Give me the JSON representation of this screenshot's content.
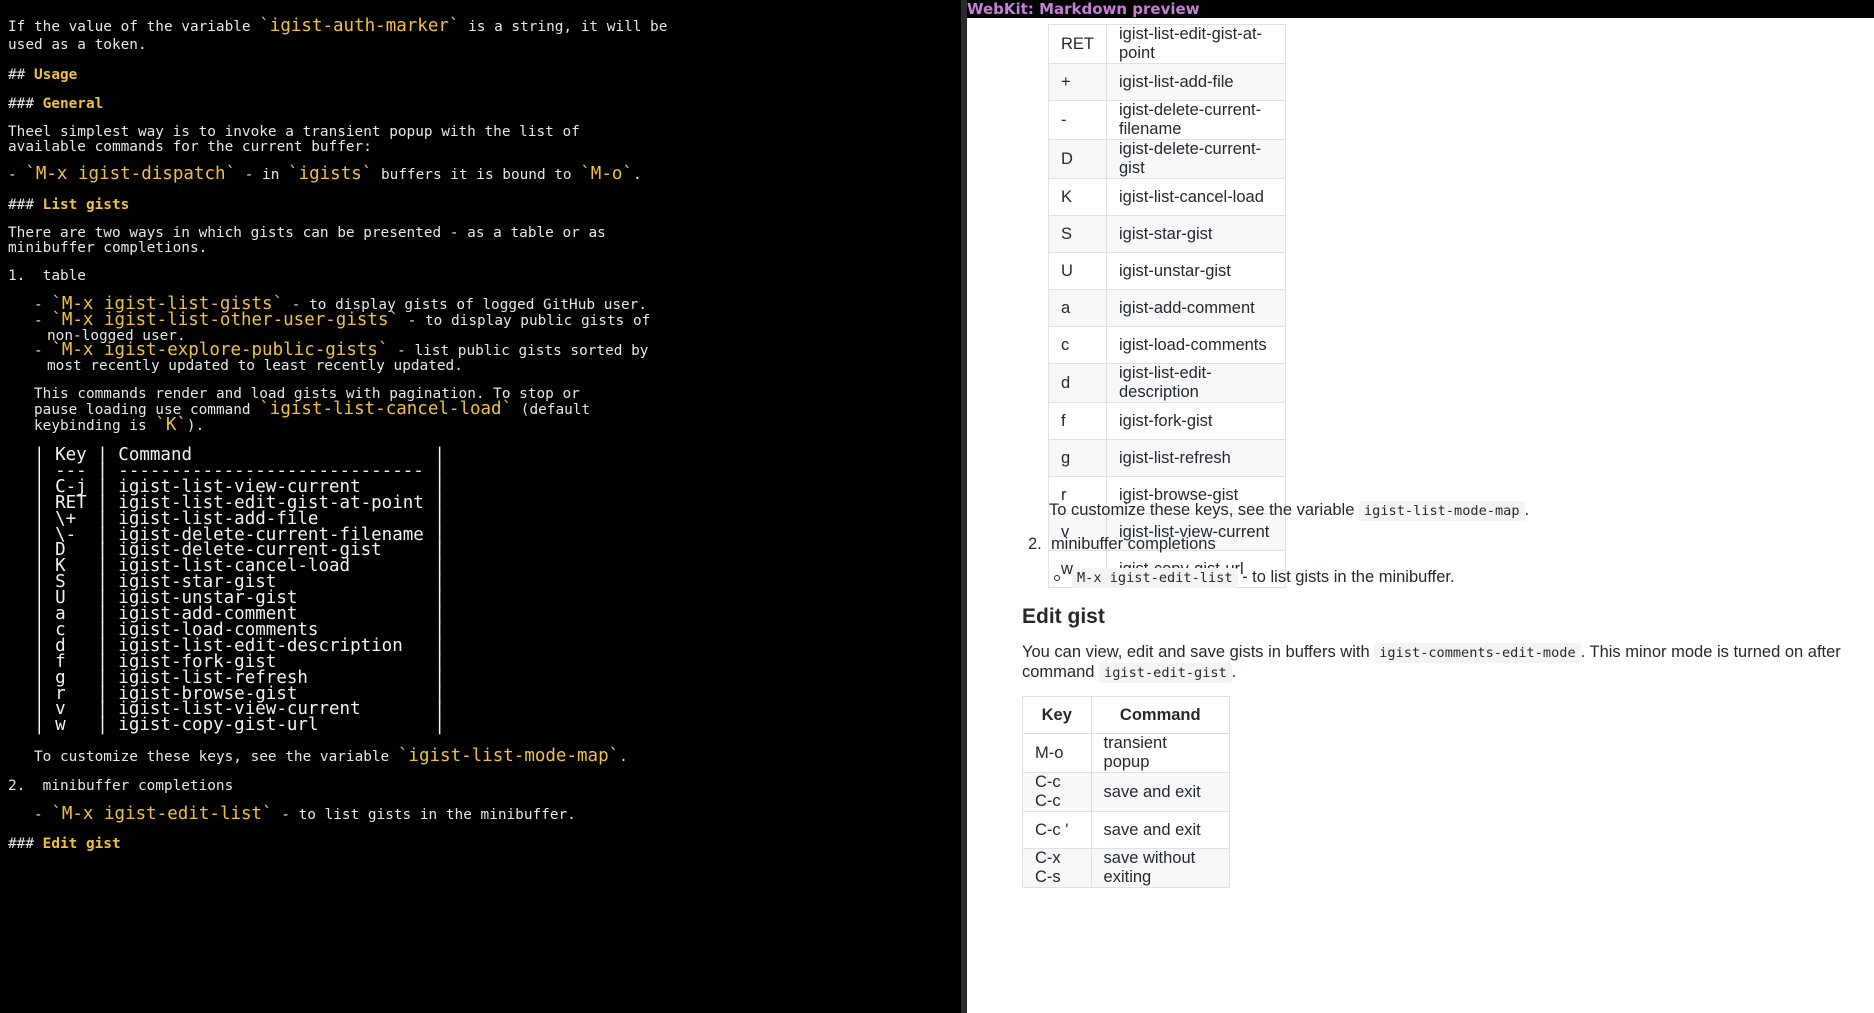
{
  "editor": {
    "para1_a": "If the value of the variable ",
    "para1_code": "`igist-auth-marker`",
    "para1_b": " is a string, it will be",
    "para1_line2": "used as a token.",
    "h2_mark": "## ",
    "h2_usage": "Usage",
    "h3_mark": "### ",
    "h3_general": "General",
    "general_line1": "Theel simplest way is to invoke a transient popup with the list of",
    "general_line2": "available commands for the current buffer:",
    "dispatch_dash": "- ",
    "dispatch_code": "`M-x igist-dispatch`",
    "dispatch_mid": " - in ",
    "dispatch_code2": "`igists`",
    "dispatch_mid2": " buffers it is bound to ",
    "dispatch_code3": "`M-o`",
    "dispatch_end": ".",
    "h3_list": "List gists",
    "list_line1": "There are two ways in which gists can be presented - as a table or as",
    "list_line2": "minibuffer completions.",
    "item1": "1.  table",
    "b1_code": "`M-x igist-list-gists`",
    "b1_text": " - to display gists of logged GitHub user.",
    "b2_code": "`M-x igist-list-other-user-gists`",
    "b2_text": " - to display public gists of",
    "b2_cont": "non-logged user.",
    "b3_code": "`M-x igist-explore-public-gists`",
    "b3_text": " - list public gists sorted by",
    "b3_cont": "most recently updated to least recently updated.",
    "pag_line1": "This commands render and load gists with pagination. To stop or",
    "pag_line2a": "pause loading use command ",
    "pag_code": "`igist-list-cancel-load`",
    "pag_line2b": " (default",
    "pag_line3a": "keybinding is ",
    "pag_code2": "`K`",
    "pag_line3b": ").",
    "table_lines": [
      "| Key | Command                       |",
      "| --- | ----------------------------- |",
      "| C-j | igist-list-view-current       |",
      "| RET | igist-list-edit-gist-at-point |",
      "| \\+  | igist-list-add-file           |",
      "| \\-  | igist-delete-current-filename |",
      "| D   | igist-delete-current-gist     |",
      "| K   | igist-list-cancel-load        |",
      "| S   | igist-star-gist               |",
      "| U   | igist-unstar-gist             |",
      "| a   | igist-add-comment             |",
      "| c   | igist-load-comments           |",
      "| d   | igist-list-edit-description   |",
      "| f   | igist-fork-gist               |",
      "| g   | igist-list-refresh            |",
      "| r   | igist-browse-gist             |",
      "| v   | igist-list-view-current       |",
      "| w   | igist-copy-gist-url           |"
    ],
    "cust_a": "To customize these keys, see the variable ",
    "cust_code": "`igist-list-mode-map`",
    "cust_b": ".",
    "item2": "2.  minibuffer completions",
    "mb_code": "`M-x igist-edit-list`",
    "mb_text": " - to list gists in the minibuffer.",
    "h3_edit": "Edit gist"
  },
  "preview": {
    "title": "WebKit: Markdown preview",
    "list_rows": [
      [
        "RET",
        "igist-list-edit-gist-at-point"
      ],
      [
        "+",
        "igist-list-add-file"
      ],
      [
        "-",
        "igist-delete-current-filename"
      ],
      [
        "D",
        "igist-delete-current-gist"
      ],
      [
        "K",
        "igist-list-cancel-load"
      ],
      [
        "S",
        "igist-star-gist"
      ],
      [
        "U",
        "igist-unstar-gist"
      ],
      [
        "a",
        "igist-add-comment"
      ],
      [
        "c",
        "igist-load-comments"
      ],
      [
        "d",
        "igist-list-edit-description"
      ],
      [
        "f",
        "igist-fork-gist"
      ],
      [
        "g",
        "igist-list-refresh"
      ],
      [
        "r",
        "igist-browse-gist"
      ],
      [
        "v",
        "igist-list-view-current"
      ],
      [
        "w",
        "igist-copy-gist-url"
      ]
    ],
    "cust_a": "To customize these keys, see the variable ",
    "cust_code": "igist-list-mode-map",
    "cust_b": ".",
    "item2_num": "2.",
    "item2_text": "minibuffer completions",
    "mb_code": "M-x igist-edit-list",
    "mb_text": " - to list gists in the minibuffer.",
    "h_edit": "Edit gist",
    "edit_a": "You can view, edit and save gists in buffers with ",
    "edit_code": "igist-comments-edit-mode",
    "edit_b": ". This minor mode is turned on after",
    "edit_c": "command ",
    "edit_code2": "igist-edit-gist",
    "edit_d": ".",
    "edit_header": [
      "Key",
      "Command"
    ],
    "edit_rows": [
      [
        "M-o",
        "transient popup"
      ],
      [
        "C-c C-c",
        "save and exit"
      ],
      [
        "C-c '",
        "save and exit"
      ],
      [
        "C-x C-s",
        "save without exiting"
      ]
    ]
  }
}
